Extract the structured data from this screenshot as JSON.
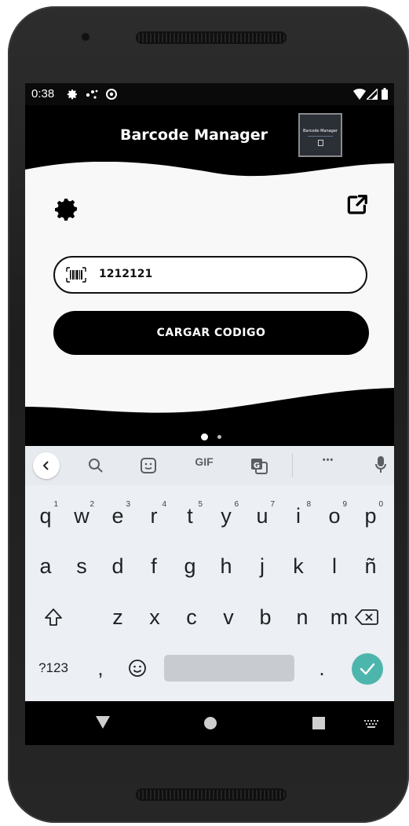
{
  "status_bar": {
    "time": "0:38"
  },
  "app": {
    "title": "Barcode Manager",
    "logo_text": "Barcode Manager"
  },
  "form": {
    "barcode_value": "1212121",
    "load_button_label": "CARGAR CODIGO"
  },
  "pager": {
    "total": 2,
    "active_index": 0
  },
  "keyboard": {
    "suggestions": {
      "gif_label": "GIF",
      "more_label": "•••"
    },
    "row1": [
      {
        "key": "q",
        "hint": "1"
      },
      {
        "key": "w",
        "hint": "2"
      },
      {
        "key": "e",
        "hint": "3"
      },
      {
        "key": "r",
        "hint": "4"
      },
      {
        "key": "t",
        "hint": "5"
      },
      {
        "key": "y",
        "hint": "6"
      },
      {
        "key": "u",
        "hint": "7"
      },
      {
        "key": "i",
        "hint": "8"
      },
      {
        "key": "o",
        "hint": "9"
      },
      {
        "key": "p",
        "hint": "0"
      }
    ],
    "row2": [
      "a",
      "s",
      "d",
      "f",
      "g",
      "h",
      "j",
      "k",
      "l",
      "ñ"
    ],
    "row3": [
      "z",
      "x",
      "c",
      "v",
      "b",
      "n",
      "m"
    ],
    "row4": {
      "symbols_label": "?123",
      "comma": ",",
      "period": "."
    }
  },
  "colors": {
    "accent_enter": "#4db6ac",
    "card_bg": "#f8f8f8",
    "header_bg": "#000000"
  },
  "icons": {
    "settings": "gear-icon",
    "share": "external-link-icon",
    "barcode": "barcode-icon",
    "keyboard_back": "chevron-left-icon",
    "enter": "checkmark-icon"
  }
}
